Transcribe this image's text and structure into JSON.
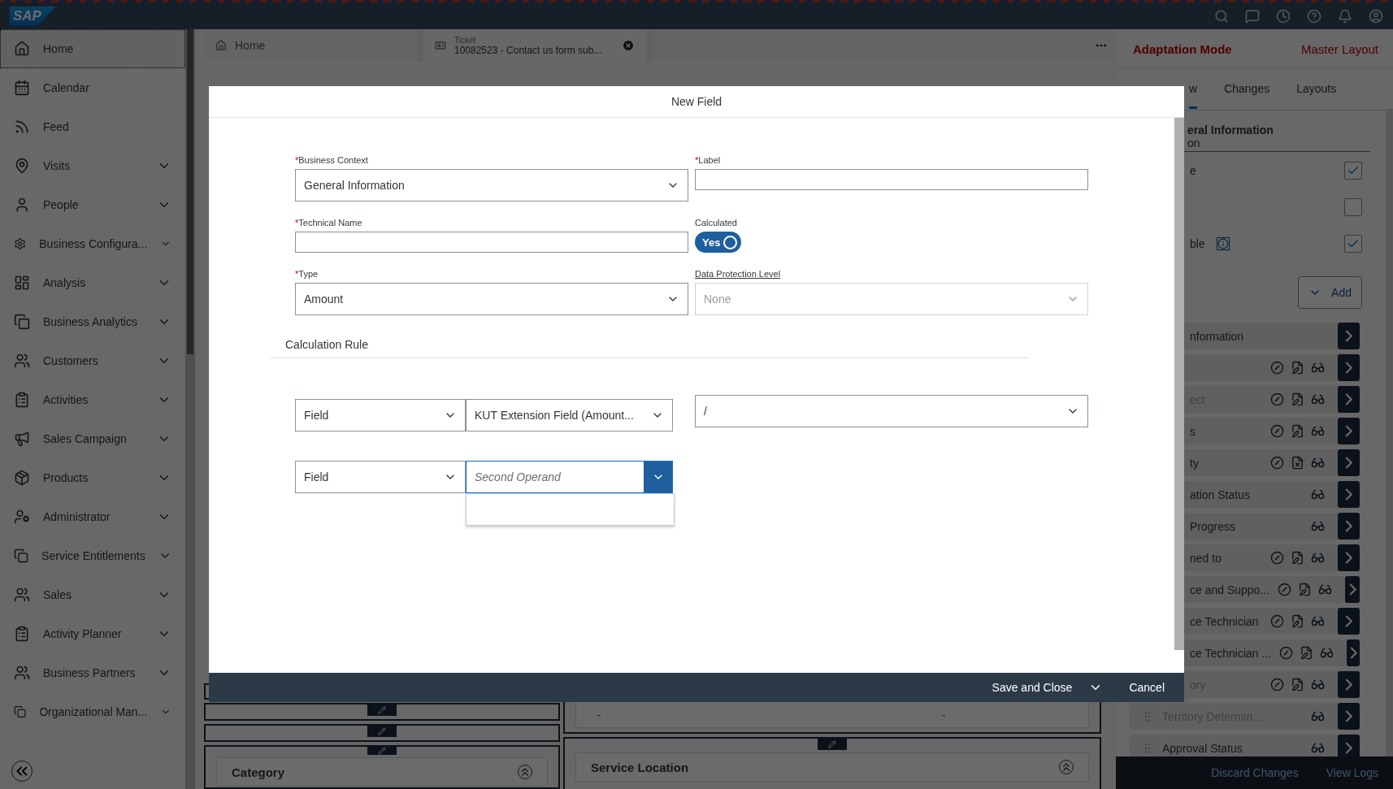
{
  "shell": {
    "logo": "SAP"
  },
  "sidebar": {
    "items": [
      {
        "label": "Home",
        "selected": true,
        "expandable": false
      },
      {
        "label": "Calendar",
        "selected": false,
        "expandable": false
      },
      {
        "label": "Feed",
        "selected": false,
        "expandable": false
      },
      {
        "label": "Visits",
        "selected": false,
        "expandable": true
      },
      {
        "label": "People",
        "selected": false,
        "expandable": true
      },
      {
        "label": "Business Configura...",
        "selected": false,
        "expandable": true
      },
      {
        "label": "Analysis",
        "selected": false,
        "expandable": true
      },
      {
        "label": "Business Analytics",
        "selected": false,
        "expandable": true
      },
      {
        "label": "Customers",
        "selected": false,
        "expandable": true
      },
      {
        "label": "Activities",
        "selected": false,
        "expandable": true
      },
      {
        "label": "Sales Campaign",
        "selected": false,
        "expandable": true
      },
      {
        "label": "Products",
        "selected": false,
        "expandable": true
      },
      {
        "label": "Administrator",
        "selected": false,
        "expandable": true
      },
      {
        "label": "Service Entitlements",
        "selected": false,
        "expandable": true
      },
      {
        "label": "Sales",
        "selected": false,
        "expandable": true
      },
      {
        "label": "Activity Planner",
        "selected": false,
        "expandable": true
      },
      {
        "label": "Business Partners",
        "selected": false,
        "expandable": true
      },
      {
        "label": "Organizational Man...",
        "selected": false,
        "expandable": true
      }
    ]
  },
  "tabs": [
    {
      "kind": "home",
      "label": "Home",
      "selected": false
    },
    {
      "kind": "object",
      "caption": "Ticket",
      "label": "10082523 - Contact us form sub...",
      "selected": true
    }
  ],
  "background_cards": {
    "dashes": [
      "-",
      "-"
    ],
    "left_title": "Category",
    "right_title": "Service Location"
  },
  "adaptation_panel": {
    "title": "Adaptation Mode",
    "layout": "Master Layout",
    "tabs": [
      {
        "label": "w",
        "selected": true
      },
      {
        "label": "Changes",
        "selected": false
      },
      {
        "label": "Layouts",
        "selected": false
      }
    ],
    "section_title": "eral Information",
    "section_subtitle": "on",
    "checkboxes": [
      {
        "label": "e",
        "info": false,
        "checked": true
      },
      {
        "info": false,
        "checked": false
      },
      {
        "label": "ble",
        "info": true,
        "checked": true
      }
    ],
    "add_button": "Add",
    "rows": [
      {
        "kind": "plain",
        "label": "nformation",
        "cut": true,
        "disabled": false
      },
      {
        "kind": "editable"
      },
      {
        "kind": "editable",
        "label": "ect",
        "cut": true,
        "disabled": true
      },
      {
        "kind": "editable",
        "label": "s",
        "cut": true,
        "disabled": false
      },
      {
        "kind": "locked",
        "label": "ty",
        "cut": true,
        "disabled": false
      },
      {
        "kind": "view",
        "label": "ation Status",
        "cut": true,
        "disabled": false
      },
      {
        "kind": "view",
        "label": "Progress",
        "cut": true,
        "disabled": false
      },
      {
        "kind": "editable",
        "label": "ned to",
        "cut": true,
        "disabled": false
      },
      {
        "kind": "editable",
        "label": "ce and Suppo...",
        "cut": true,
        "disabled": false
      },
      {
        "kind": "editable",
        "label": "ce Technician",
        "cut": true,
        "disabled": false
      },
      {
        "kind": "editable",
        "label": "ce Technician ...",
        "cut": true,
        "disabled": false
      },
      {
        "kind": "editable",
        "label": "ory",
        "cut": true,
        "disabled": true
      },
      {
        "kind": "view",
        "label": "Territory Determin...",
        "cut": false,
        "disabled": true
      },
      {
        "kind": "view",
        "label": "Approval Status",
        "cut": false,
        "disabled": false
      }
    ],
    "footer": [
      "Discard Changes",
      "View Logs"
    ]
  },
  "dialog": {
    "title": "New Field",
    "fields": [
      {
        "kind": "select",
        "required_mark": "*",
        "label": "Business Context",
        "value": "General Information",
        "disabled": false
      },
      {
        "kind": "input",
        "required_mark": "*",
        "label": "Label"
      },
      {
        "kind": "input",
        "required_mark": "*",
        "label": "Technical Name"
      },
      {
        "kind": "switch",
        "label": "Calculated",
        "text": "Yes",
        "on": true
      },
      {
        "kind": "select",
        "required_mark": "*",
        "label": "Type",
        "value": "Amount",
        "disabled": false
      },
      {
        "kind": "select",
        "label": "Data Protection Level",
        "value": "None",
        "disabled": true
      }
    ],
    "calculation_rule": {
      "title": "Calculation Rule",
      "first_source": "Field",
      "first_value": "KUT Extension Field (Amount...",
      "operator": "/",
      "second_source": "Field",
      "second_placeholder": "Second Operand",
      "second_open": true
    },
    "buttons": {
      "primary": "Save and Close",
      "cancel": "Cancel"
    }
  }
}
